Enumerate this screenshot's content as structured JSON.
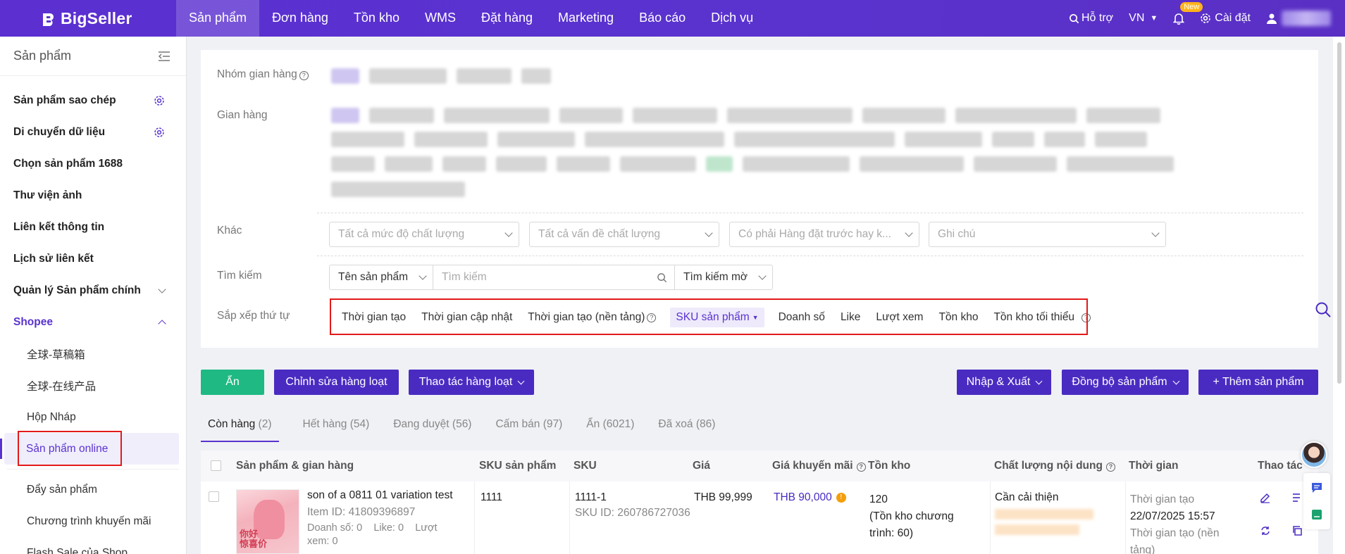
{
  "brand": {
    "name": "BigSeller"
  },
  "nav": [
    "Sản phẩm",
    "Đơn hàng",
    "Tồn kho",
    "WMS",
    "Đặt hàng",
    "Marketing",
    "Báo cáo",
    "Dịch vụ"
  ],
  "topright": {
    "support": "Hỗ trợ",
    "lang": "VN",
    "new_badge": "New",
    "settings": "Cài đặt"
  },
  "sidebar": {
    "title": "Sản phẩm",
    "items": [
      "Sản phẩm sao chép",
      "Di chuyển dữ liệu",
      "Chọn sản phẩm 1688",
      "Thư viện ảnh",
      "Liên kết thông tin",
      "Lịch sử liên kết",
      "Quản lý Sản phẩm chính",
      "Shopee"
    ],
    "sub": [
      "全球-草稿箱",
      "全球-在线产品",
      "Hộp Nháp",
      "Sản phẩm online",
      "Đẩy sản phẩm",
      "Chương trình khuyến mãi",
      "Flash Sale của Shop"
    ]
  },
  "filters": {
    "group_label": "Nhóm gian hàng",
    "shop_label": "Gian hàng",
    "other_label": "Khác",
    "search_label": "Tìm kiếm",
    "sort_label": "Sắp xếp thứ tự",
    "other_selects": [
      "Tất cả mức độ chất lượng",
      "Tất cả vấn đề chất lượng",
      "Có phải Hàng đặt trước hay k...",
      "Ghi chú"
    ],
    "search_field": "Tên sản phẩm",
    "search_placeholder": "Tìm kiếm",
    "search_mode": "Tìm kiếm mờ",
    "sort_options": [
      "Thời gian tạo",
      "Thời gian cập nhật",
      "Thời gian tạo (nền tảng)",
      "SKU sản phẩm",
      "Doanh số",
      "Like",
      "Lượt xem",
      "Tồn kho",
      "Tồn kho tối thiểu"
    ]
  },
  "actions": {
    "hide": "Ẩn",
    "bulk_edit": "Chỉnh sửa hàng loạt",
    "bulk_ops": "Thao tác hàng loạt",
    "import_export": "Nhập & Xuất",
    "sync": "Đồng bộ sản phẩm",
    "add": "+ Thêm sản phẩm"
  },
  "tabs": [
    {
      "label": "Còn hàng",
      "count": "(2)"
    },
    {
      "label": "Hết hàng",
      "count": "(54)"
    },
    {
      "label": "Đang duyệt",
      "count": "(56)"
    },
    {
      "label": "Cấm bán",
      "count": "(97)"
    },
    {
      "label": "Ẩn",
      "count": "(6021)"
    },
    {
      "label": "Đã xoá",
      "count": "(86)"
    }
  ],
  "table": {
    "headers": [
      "Sản phẩm & gian hàng",
      "SKU sản phẩm",
      "SKU",
      "Giá",
      "Giá khuyến mãi",
      "Tồn kho",
      "Chất lượng nội dung",
      "Thời gian",
      "Thao tác"
    ],
    "row": {
      "name": "son of a 0811 01 variation test",
      "item_id": "Item ID: 41809396897",
      "sales": "Doanh số: 0",
      "likes": "Like: 0",
      "views_a": "Lượt",
      "views_b": "xem: 0",
      "thumb_text_a": "你好",
      "thumb_text_b": "惊喜价",
      "product_sku": "1111",
      "sku": "1111-1",
      "sku_id": "SKU ID: 260786727036",
      "price": "THB 99,999",
      "promo_price": "THB 90,000",
      "stock": "120",
      "stock_note_a": "(Tồn kho chương",
      "stock_note_b": "trình: 60)",
      "quality": "Cần cải thiện",
      "time_label": "Thời gian tạo",
      "time_value": "22/07/2025 15:57",
      "time_label2": "Thời gian tạo (nền",
      "time_label2b": "tảng)"
    }
  },
  "colors": {
    "brand": "#5a33cf",
    "green": "#1fb983",
    "button": "#4a2bc2",
    "highlight": "#e21a1a"
  }
}
